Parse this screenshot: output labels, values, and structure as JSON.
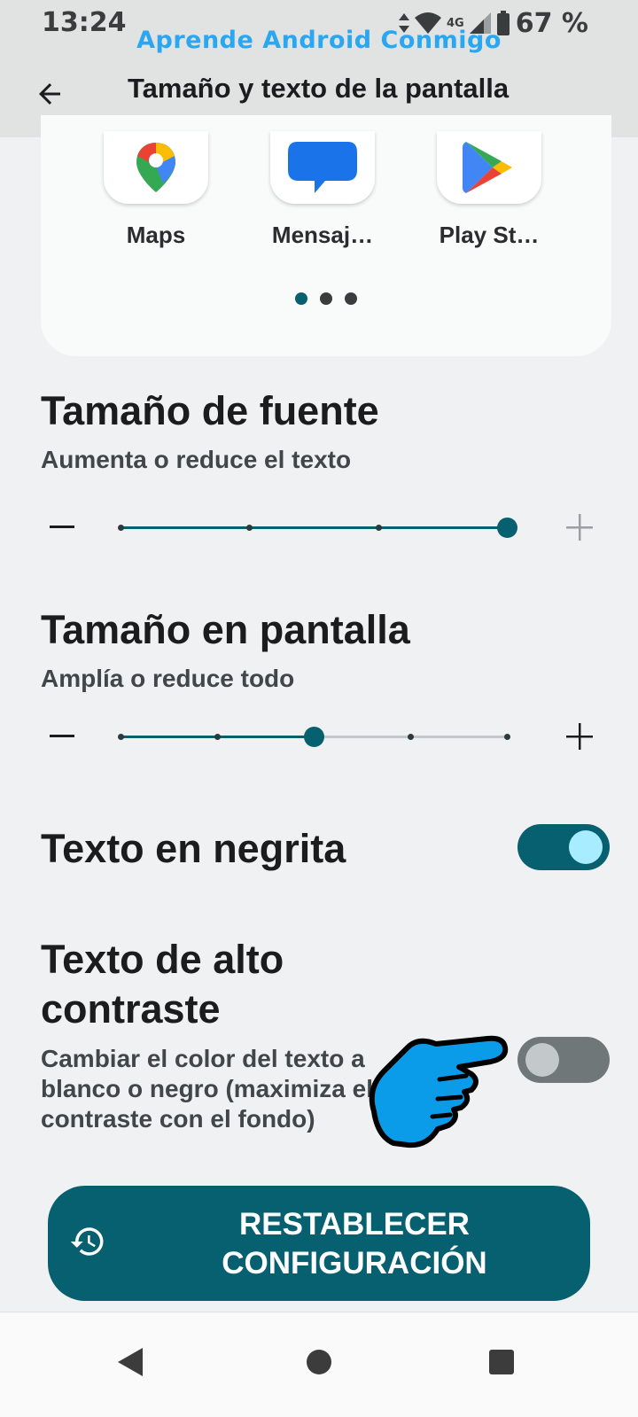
{
  "status_bar": {
    "time": "13:24",
    "network": "4G",
    "battery_percent": "67 %"
  },
  "watermark": "Aprende Android Conmigo",
  "app_bar": {
    "title": "Tamaño y texto de la pantalla",
    "back_icon": "arrow-back-icon"
  },
  "preview": {
    "apps": [
      {
        "label": "Maps",
        "icon": "maps-icon"
      },
      {
        "label": "Mensaj…",
        "icon": "messages-icon"
      },
      {
        "label": "Play St…",
        "icon": "play-store-icon"
      }
    ],
    "page_count": 3,
    "active_page": 0
  },
  "font_size": {
    "title": "Tamaño de fuente",
    "subtitle": "Aumenta o reduce el texto",
    "steps": 4,
    "selected_index": 3
  },
  "display_size": {
    "title": "Tamaño en pantalla",
    "subtitle": "Amplía o reduce todo",
    "steps": 5,
    "selected_index": 2
  },
  "bold_text": {
    "label": "Texto en negrita",
    "enabled": true
  },
  "high_contrast": {
    "label_line1": "Texto de alto",
    "label_line2": "contraste",
    "description": "Cambiar el color del texto a blanco o negro (maximiza el contraste con el fondo)",
    "enabled": false
  },
  "reset": {
    "label_line1": "RESTABLECER",
    "label_line2": "CONFIGURACIÓN",
    "icon": "history-icon"
  },
  "colors": {
    "accent": "#07606f",
    "toggle_knob_on": "#a8edff",
    "watermark": "#2aa7f0"
  }
}
